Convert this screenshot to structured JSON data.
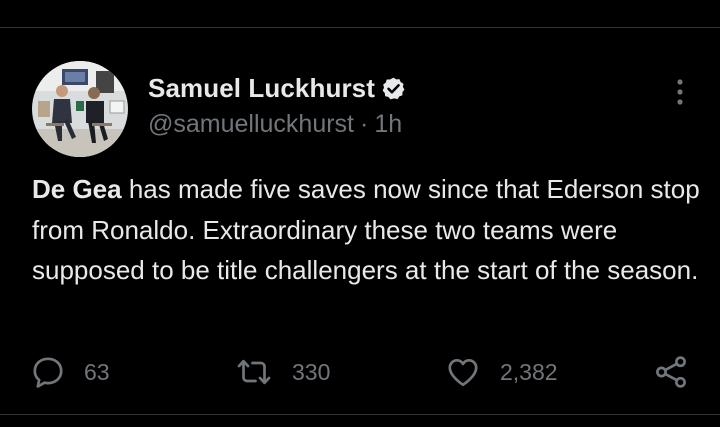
{
  "tweet": {
    "author_name": "Samuel Luckhurst",
    "handle": "@samuelluckhurst",
    "separator": "·",
    "time": "1h",
    "text_bold": "De Gea",
    "text_rest": " has made five saves now since that Ederson stop from Ronaldo. Extraordinary these two teams were supposed to be title challengers at the start of the season."
  },
  "icons": {
    "verified": "verified-badge-icon",
    "more": "more-vertical-icon",
    "reply": "reply-bubble-icon",
    "retweet": "retweet-icon",
    "like": "heart-icon",
    "share": "share-icon"
  },
  "actions": {
    "reply_count": "63",
    "retweet_count": "330",
    "like_count": "2,382"
  },
  "colors": {
    "background": "#000000",
    "text": "#e7e9ea",
    "secondary": "#71767b",
    "divider": "#2f3336"
  }
}
